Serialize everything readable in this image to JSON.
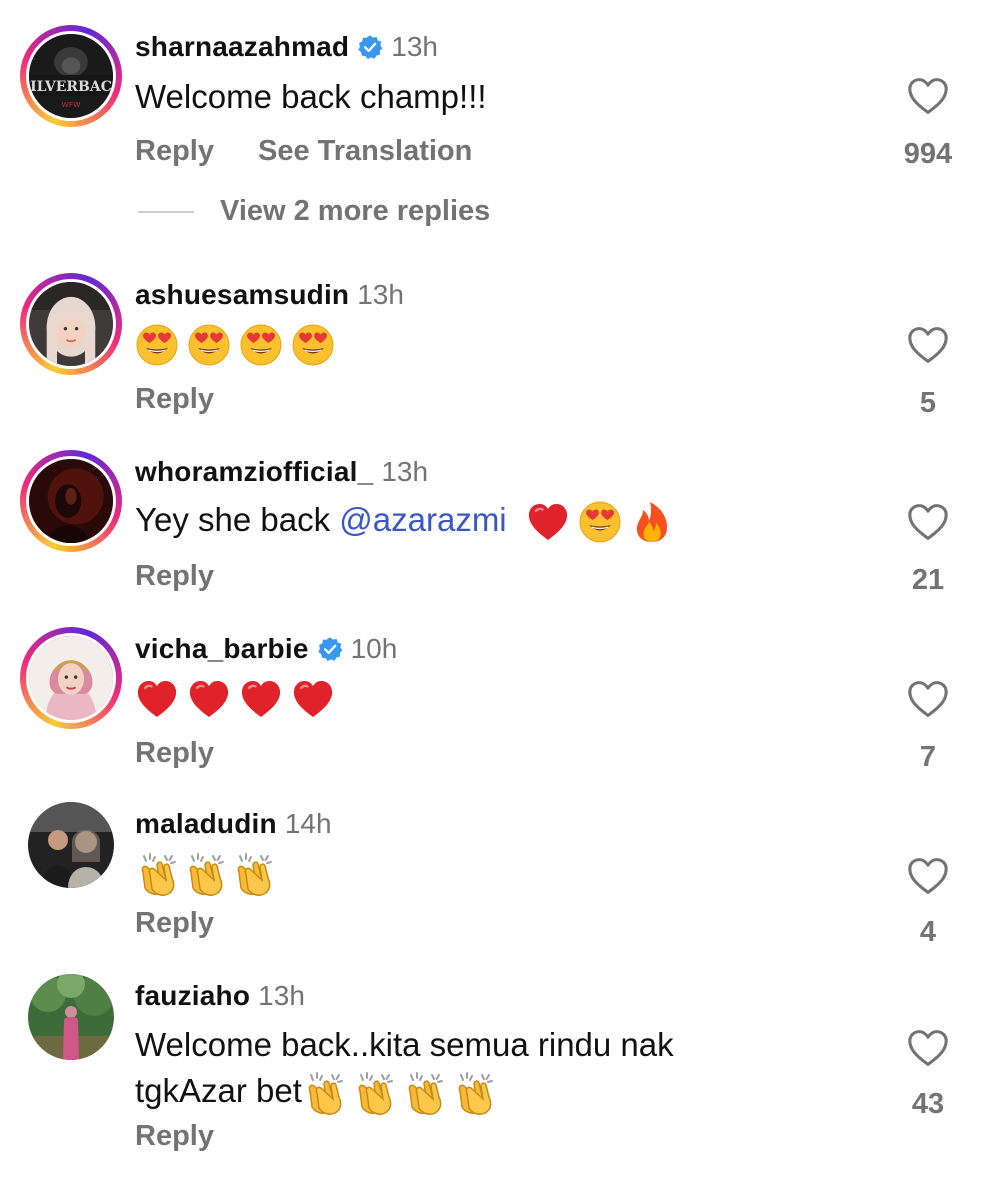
{
  "comments": [
    {
      "username": "sharnaazahmad",
      "verified": true,
      "time": "13h",
      "text": "Welcome back champ!!!",
      "reply_label": "Reply",
      "translation_label": "See Translation",
      "likes": "994",
      "view_replies_label": "View 2 more replies",
      "avatar_text": "ILVERBAC",
      "avatar_subtext": "WFW"
    },
    {
      "username": "ashuesamsudin",
      "verified": false,
      "time": "13h",
      "emojis": [
        "heart-eyes",
        "heart-eyes",
        "heart-eyes",
        "heart-eyes"
      ],
      "reply_label": "Reply",
      "likes": "5"
    },
    {
      "username": "whoramziofficial_",
      "verified": false,
      "time": "13h",
      "text": "Yey she back ",
      "mention": "@azarazmi",
      "emojis": [
        "red-heart",
        "heart-eyes",
        "fire"
      ],
      "reply_label": "Reply",
      "likes": "21"
    },
    {
      "username": "vicha_barbie",
      "verified": true,
      "time": "10h",
      "emojis": [
        "red-heart",
        "red-heart",
        "red-heart",
        "red-heart"
      ],
      "reply_label": "Reply",
      "likes": "7"
    },
    {
      "username": "maladudin",
      "verified": false,
      "time": "14h",
      "emojis": [
        "clapping-hands",
        "clapping-hands",
        "clapping-hands"
      ],
      "reply_label": "Reply",
      "likes": "4"
    },
    {
      "username": "fauziaho",
      "verified": false,
      "time": "13h",
      "text_line1": "Welcome back..kita semua rindu nak",
      "text_line2": "tgkAzar bet",
      "emojis": [
        "clapping-hands",
        "clapping-hands",
        "clapping-hands",
        "clapping-hands"
      ],
      "reply_label": "Reply",
      "likes": "43"
    }
  ],
  "colors": {
    "secondary_text": "#737373",
    "mention": "#3a57c9",
    "verified_badge": "#3897f0"
  },
  "icons": {
    "like": "heart-outline-icon",
    "verified": "verified-badge-icon"
  }
}
